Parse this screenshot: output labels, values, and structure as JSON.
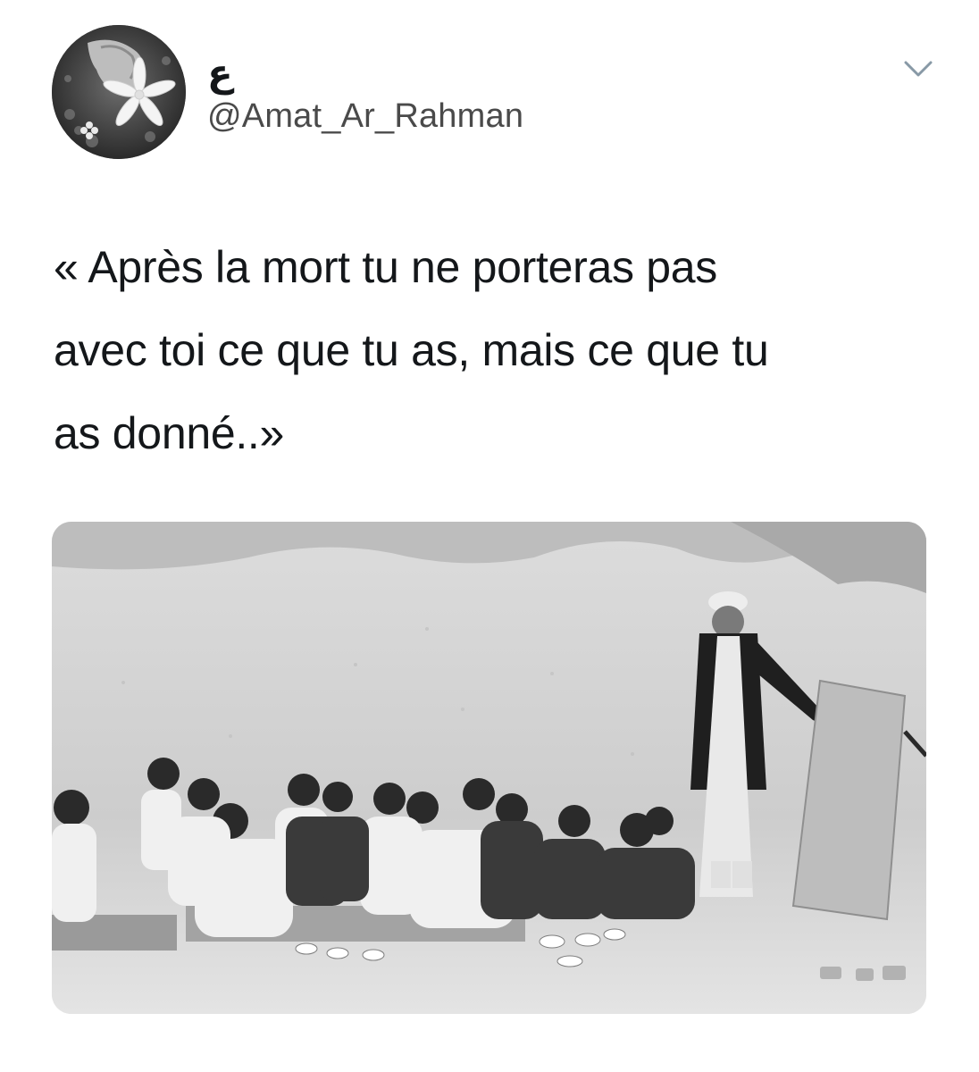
{
  "tweet": {
    "author": {
      "display_name": "ع",
      "handle": "@Amat_Ar_Rahman"
    },
    "text": "« Après la mort tu ne porteras pas\navec toi ce que tu as, mais ce que tu\nas donné..»",
    "menu_icon": "chevron-down-icon",
    "media": {
      "kind": "photo",
      "style": "black-and-white"
    }
  },
  "colors": {
    "text": "#14171a",
    "handle": "#4a4a4a",
    "caret": "#8899a6",
    "background": "#ffffff"
  }
}
